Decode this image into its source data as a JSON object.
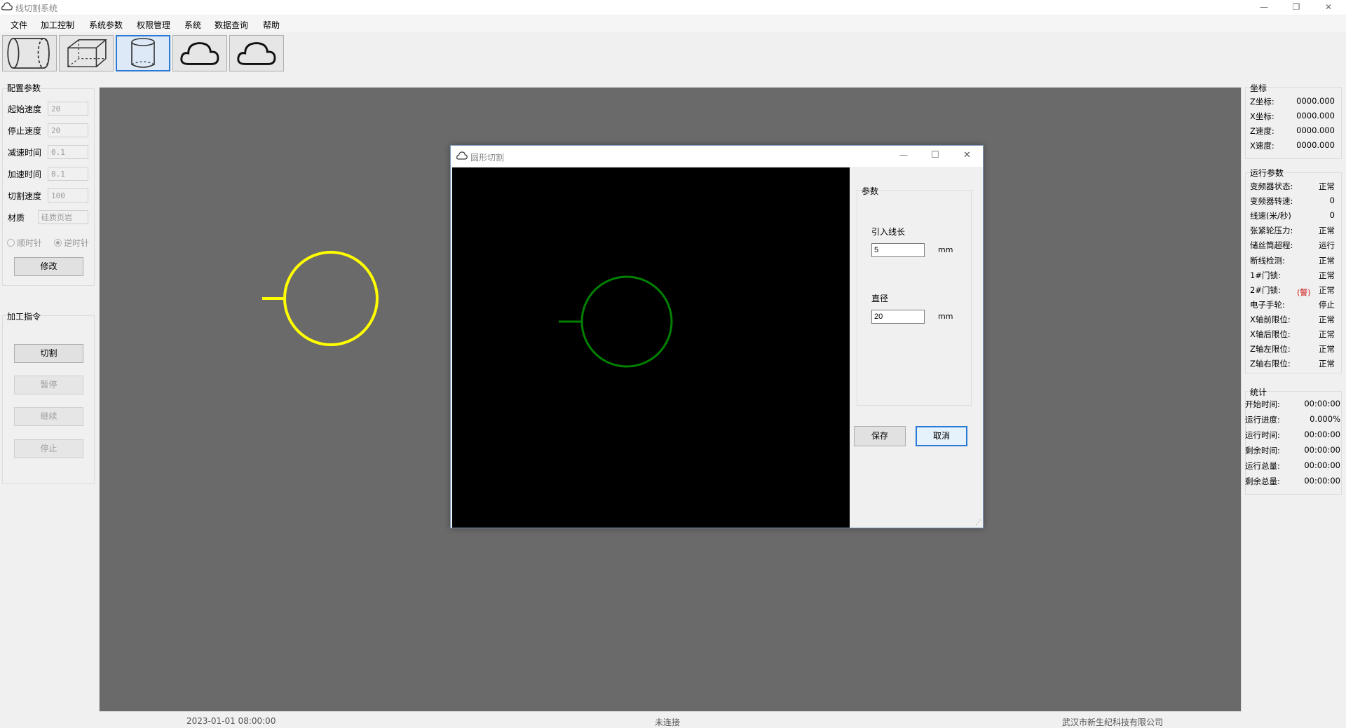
{
  "window": {
    "title": "线切割系统",
    "controls": {
      "minimize": "—",
      "maximize": "❐",
      "close": "✕"
    }
  },
  "menu": [
    "文件",
    "加工控制",
    "系统参数",
    "权限管理",
    "系统",
    "数据查询",
    "帮助"
  ],
  "toolbar": [
    "cylinder-horizontal-icon",
    "cube-icon",
    "cylinder-vertical-icon",
    "cloud-icon",
    "cloud-icon"
  ],
  "config": {
    "title": "配置参数",
    "fields": [
      {
        "label": "起始速度",
        "value": "20"
      },
      {
        "label": "停止速度",
        "value": "20"
      },
      {
        "label": "减速时间",
        "value": "0.1"
      },
      {
        "label": "加速时间",
        "value": "0.1"
      },
      {
        "label": "切割速度",
        "value": "100"
      },
      {
        "label": "材质",
        "value": "硅质页岩"
      }
    ],
    "radio_cw": "顺时针",
    "radio_ccw": "逆时针",
    "modify_button": "修改"
  },
  "commands": {
    "title": "加工指令",
    "buttons": [
      "切割",
      "暂停",
      "继续",
      "停止"
    ]
  },
  "coords": {
    "title": "坐标",
    "rows": [
      {
        "label": "Z坐标:",
        "value": "0000.000"
      },
      {
        "label": "X坐标:",
        "value": "0000.000"
      },
      {
        "label": "Z速度:",
        "value": "0000.000"
      },
      {
        "label": "X速度:",
        "value": "0000.000"
      }
    ]
  },
  "run_params": {
    "title": "运行参数",
    "rows": [
      {
        "label": "变频器状态:",
        "value": "正常"
      },
      {
        "label": "变频器转速:",
        "value": "0"
      },
      {
        "label": "线速(米/秒)",
        "value": "0"
      },
      {
        "label": "张紧轮压力:",
        "value": "正常"
      },
      {
        "label": "储丝筒超程:",
        "value": "运行"
      },
      {
        "label": "断线检测:",
        "value": "正常"
      },
      {
        "label": "1#门锁:",
        "value": "正常"
      },
      {
        "label": "2#门锁:",
        "value": "正常"
      },
      {
        "label": "电子手轮:",
        "value": "停止"
      },
      {
        "label": "X轴前限位:",
        "value": "正常"
      },
      {
        "label": "X轴后限位:",
        "value": "正常"
      },
      {
        "label": "Z轴左限位:",
        "value": "正常"
      },
      {
        "label": "Z轴右限位:",
        "value": "正常"
      }
    ],
    "alarm_badge": "警"
  },
  "stats": {
    "title": "统计",
    "rows": [
      {
        "label": "开始时间:",
        "value": "00:00:00"
      },
      {
        "label": "运行进度:",
        "value": "0.000%"
      },
      {
        "label": "运行时间:",
        "value": "00:00:00"
      },
      {
        "label": "剩余时间:",
        "value": "00:00:00"
      },
      {
        "label": "运行总量:",
        "value": "00:00:00"
      },
      {
        "label": "剩余总量:",
        "value": "00:00:00"
      }
    ]
  },
  "dialog": {
    "title": "圆形切割",
    "group_title": "参数",
    "lead_label": "引入线长",
    "lead_value": "5",
    "diameter_label": "直径",
    "diameter_value": "20",
    "unit": "mm",
    "save_button": "保存",
    "cancel_button": "取消"
  },
  "colors": {
    "main_shape": "#ffff00",
    "preview_shape": "#008000",
    "canvas_bg": "#6a6a6a"
  },
  "status": {
    "datetime": "2023-01-01 08:00:00",
    "connection": "未连接",
    "company": "武汉市新生纪科技有限公司"
  }
}
